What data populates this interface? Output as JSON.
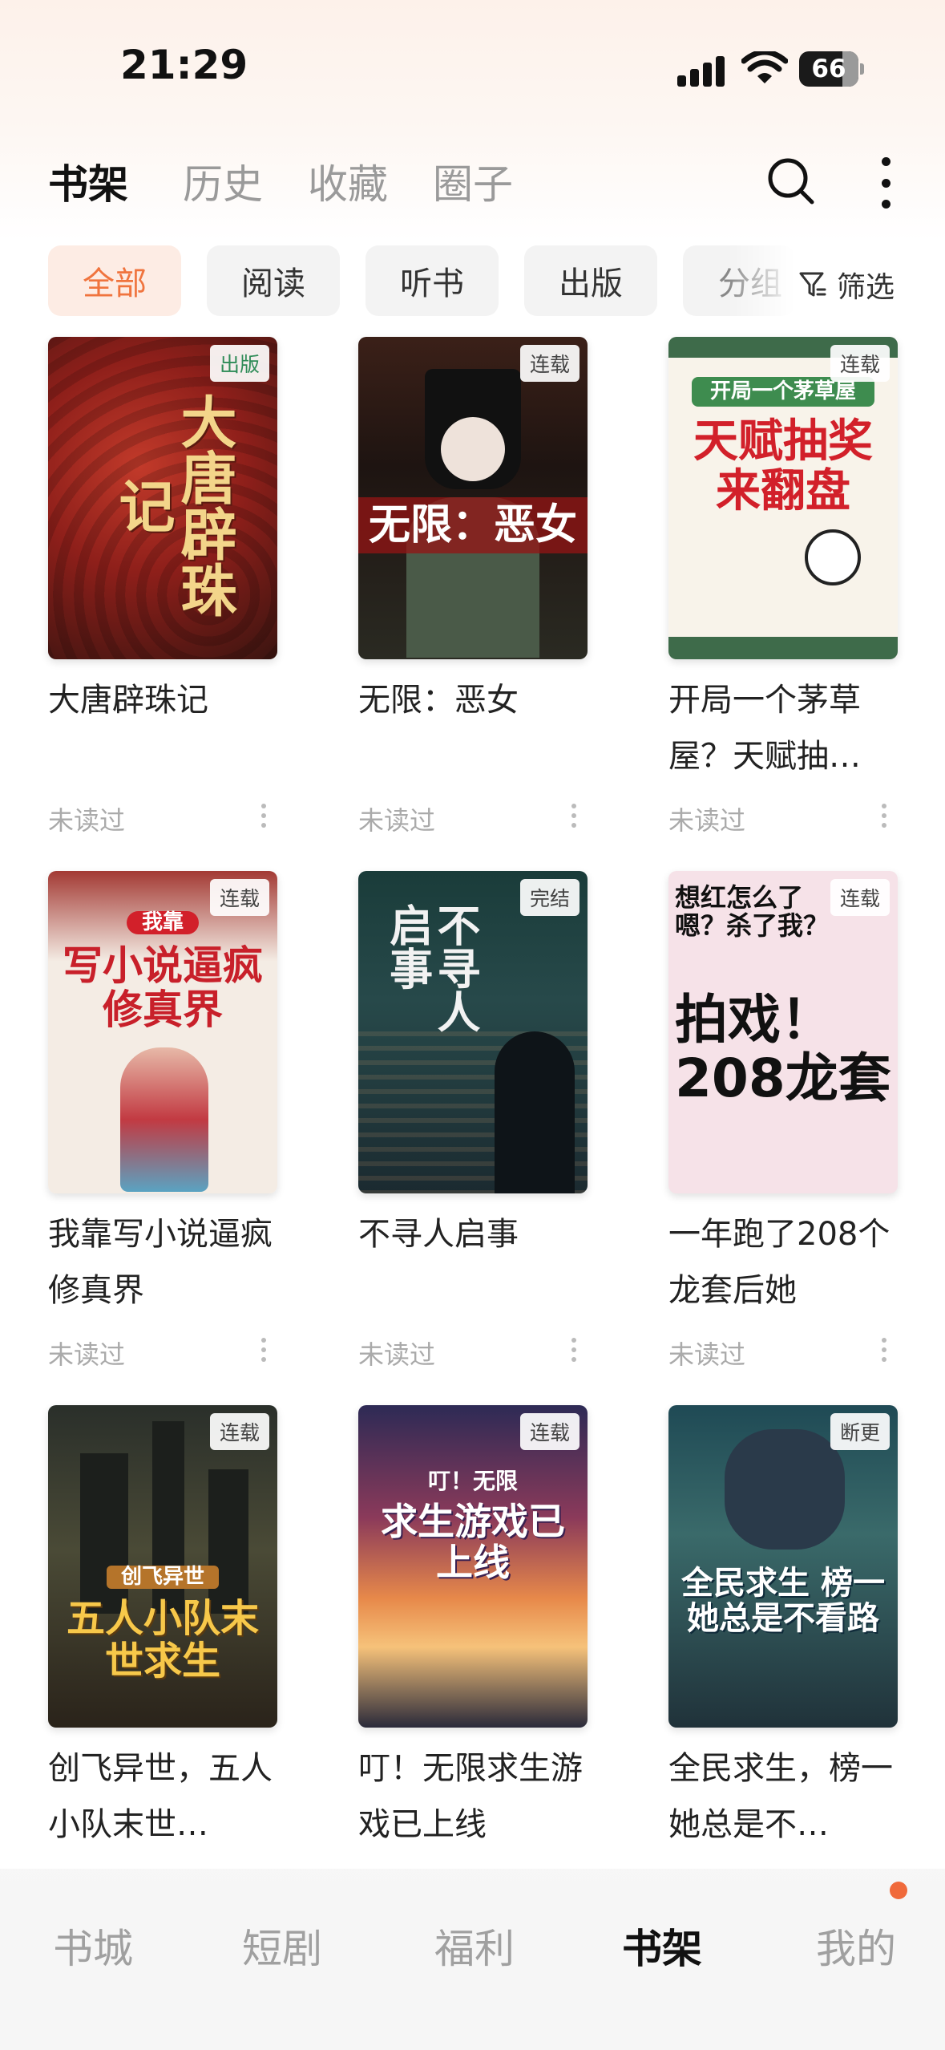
{
  "status_bar": {
    "time": "21:29",
    "battery": "66"
  },
  "header": {
    "tabs": [
      {
        "label": "书架",
        "active": true
      },
      {
        "label": "历史",
        "active": false
      },
      {
        "label": "收藏",
        "active": false
      },
      {
        "label": "圈子",
        "active": false
      }
    ],
    "search_icon": "search-icon",
    "more_icon": "more-vertical-icon"
  },
  "filters": {
    "chips": [
      {
        "label": "全部",
        "active": true
      },
      {
        "label": "阅读",
        "active": false
      },
      {
        "label": "听书",
        "active": false
      },
      {
        "label": "出版",
        "active": false
      },
      {
        "label": "分组",
        "active": false
      }
    ],
    "filter_label": "筛选",
    "filter_icon": "filter-icon"
  },
  "books": [
    {
      "title": "大唐辟珠记",
      "badge": "出版",
      "status": "未读过",
      "cover_text": "大唐辟珠记"
    },
    {
      "title": "无限：恶女",
      "badge": "连载",
      "status": "未读过",
      "cover_text": "无限：恶女"
    },
    {
      "title": "开局一个茅草屋？天赋抽…",
      "badge": "连载",
      "status": "未读过",
      "cover_text": "天赋抽奖来翻盘",
      "cover_sub": "开局一个茅草屋"
    },
    {
      "title": "我靠写小说逼疯修真界",
      "badge": "连载",
      "status": "未读过",
      "cover_text": "写小说逼疯修真界",
      "cover_sub": "我靠"
    },
    {
      "title": "不寻人启事",
      "badge": "完结",
      "status": "未读过",
      "cover_text": "不寻人启事"
    },
    {
      "title": "一年跑了208个龙套后她",
      "badge": "连载",
      "status": "未读过",
      "cover_text": "拍戏！208龙套",
      "cover_sub": "想红怎么了 嗯？杀了我？"
    },
    {
      "title": "创飞异世，五人小队末世…",
      "badge": "连载",
      "status": "未读过",
      "cover_text": "五人小队末世求生",
      "cover_sub": "创飞异世"
    },
    {
      "title": "叮！无限求生游戏已上线",
      "badge": "连载",
      "status": "未读过",
      "cover_text": "求生游戏已上线",
      "cover_sub": "叮！无限"
    },
    {
      "title": "全民求生，榜一她总是不…",
      "badge": "断更",
      "status": "未读过",
      "cover_text": "全民求生 榜一她总是不看路"
    }
  ],
  "bottom_nav": [
    {
      "label": "书城",
      "active": false
    },
    {
      "label": "短剧",
      "active": false
    },
    {
      "label": "福利",
      "active": false
    },
    {
      "label": "书架",
      "active": true
    },
    {
      "label": "我的",
      "active": false
    }
  ],
  "colors": {
    "accent": "#f0743e",
    "badge_dot": "#f06a3b"
  }
}
